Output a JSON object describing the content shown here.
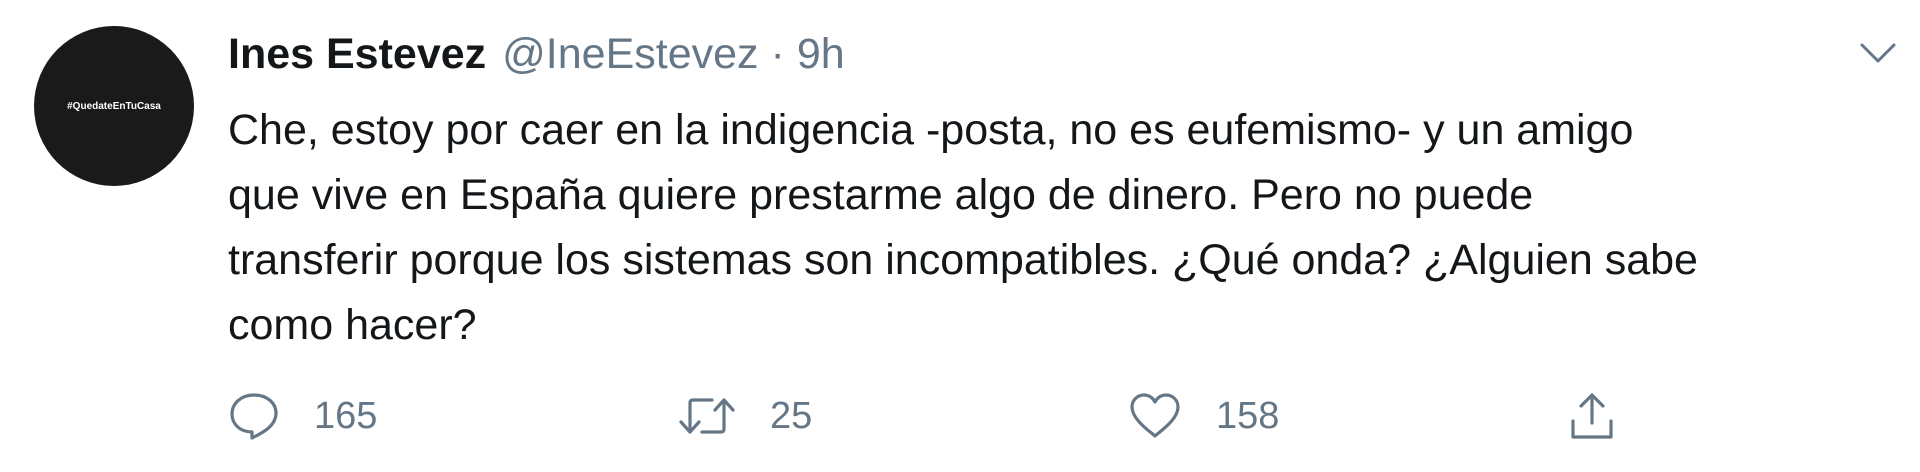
{
  "tweet": {
    "avatar_text": "#QuedateEnTuCasa",
    "author_name": "Ines Estevez",
    "handle": "@IneEstevez",
    "separator": "·",
    "time": "9h",
    "text_lines": [
      "Che, estoy por caer en la indigencia -posta, no es eufemismo- y un amigo",
      "que vive en España quiere prestarme algo de dinero. Pero no puede",
      "transferir porque los sistemas son incompatibles. ¿Qué onda? ¿Alguien sabe",
      "como hacer?"
    ],
    "actions": {
      "reply_count": "165",
      "retweet_count": "25",
      "like_count": "158"
    }
  },
  "icons": {
    "menu": "chevron-down-icon",
    "reply": "speech-bubble-icon",
    "retweet": "retweet-arrows-icon",
    "like": "heart-icon",
    "share": "share-upload-icon"
  },
  "colors": {
    "text": "#14171a",
    "secondary": "#657786",
    "avatar_bg": "#1a1a1a"
  }
}
